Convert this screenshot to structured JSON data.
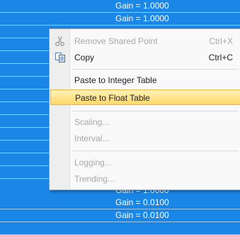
{
  "background": {
    "rows": [
      {
        "text": "Gain = 1.0000"
      },
      {
        "text": "Gain = 1.0000"
      },
      {
        "text": ""
      },
      {
        "text": ""
      },
      {
        "text": ""
      },
      {
        "text": ""
      },
      {
        "text": ""
      },
      {
        "text": ""
      },
      {
        "text": ""
      },
      {
        "text": ""
      },
      {
        "text": ""
      },
      {
        "text": ""
      },
      {
        "text": ""
      },
      {
        "text": ""
      },
      {
        "text": "Gain = 1.0000"
      },
      {
        "text": "Gain = 0.0100"
      },
      {
        "text": "Gain = 0.0100"
      },
      {
        "text": ""
      }
    ]
  },
  "menu": {
    "remove_shared_point": {
      "label": "Remove Shared Point",
      "shortcut": "Ctrl+X",
      "icon": "scissors-icon"
    },
    "copy": {
      "label": "Copy",
      "shortcut": "Ctrl+C",
      "icon": "copy-icon"
    },
    "paste_integer": {
      "label": "Paste to Integer Table"
    },
    "paste_float": {
      "label": "Paste to Float Table"
    },
    "scaling": {
      "label": "Scaling..."
    },
    "interval": {
      "label": "Interval..."
    },
    "logging": {
      "label": "Logging..."
    },
    "trending": {
      "label": "Trending..."
    }
  },
  "colors": {
    "grid_background": "#1a86e6",
    "highlight": "#ffd86a",
    "disabled_text": "#a8a8a8"
  }
}
